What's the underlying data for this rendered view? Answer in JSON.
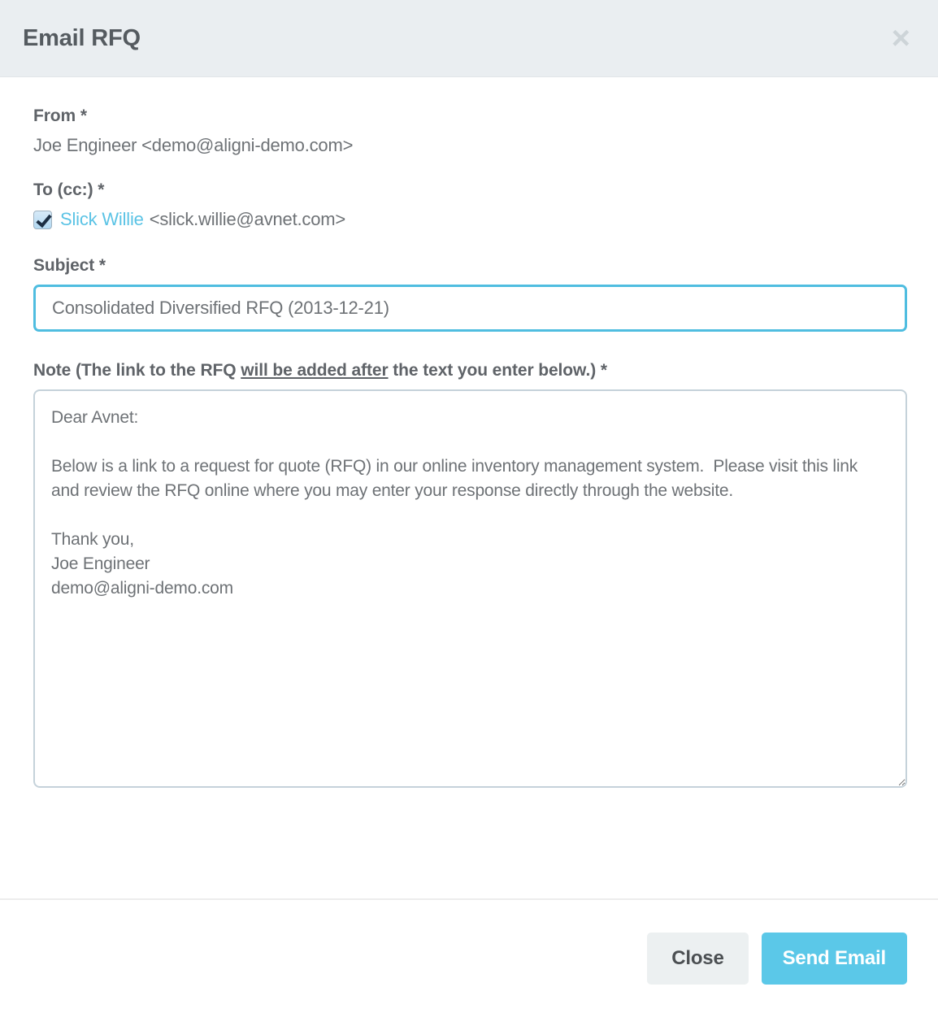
{
  "dialog": {
    "title": "Email RFQ",
    "close_icon": "close-x-icon"
  },
  "form": {
    "from": {
      "label": "From *",
      "value": "Joe Engineer <demo@aligni-demo.com>"
    },
    "to_cc": {
      "label": "To (cc:) *",
      "checked": true,
      "recipient_name": "Slick Willie",
      "recipient_email": "<slick.willie@avnet.com>"
    },
    "subject": {
      "label": "Subject *",
      "value": "Consolidated Diversified RFQ (2013-12-21)",
      "placeholder": ""
    },
    "note": {
      "label_before": "Note (The link to the RFQ ",
      "label_underlined": "will be added after",
      "label_after": " the text you enter below.) *",
      "value": "Dear Avnet:\n\nBelow is a link to a request for quote (RFQ) in our online inventory management system.  Please visit this link and review the RFQ online where you may enter your response directly through the website.\n\nThank you,\nJoe Engineer\ndemo@aligni-demo.com",
      "placeholder": ""
    }
  },
  "footer": {
    "close_label": "Close",
    "send_label": "Send Email"
  },
  "colors": {
    "accent": "#5bc8e8",
    "focus_border": "#4fbde0",
    "header_bg": "#eaeef1",
    "label_text": "#5f6368",
    "body_text": "#6e7276",
    "close_btn_bg": "#ecf0f1"
  }
}
